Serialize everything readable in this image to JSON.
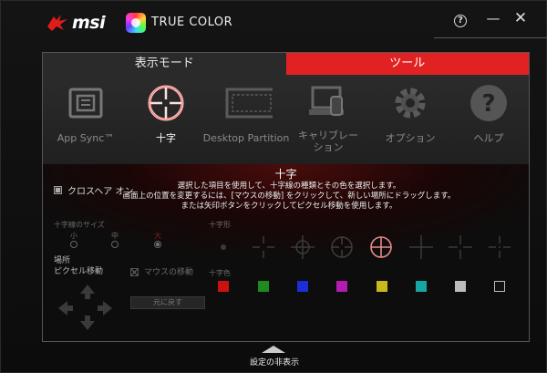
{
  "header": {
    "brand": "msi",
    "product": "TRUE COLOR",
    "help_symbol": "?",
    "minimize_symbol": "—",
    "close_symbol": "✕"
  },
  "tabs": [
    {
      "label": "表示モード",
      "active": false
    },
    {
      "label": "ツール",
      "active": true
    }
  ],
  "tools": [
    {
      "label": "App Sync™",
      "icon": "app-sync-icon"
    },
    {
      "label": "十字",
      "icon": "crosshair-icon",
      "active": true
    },
    {
      "label": "Desktop Partition",
      "icon": "desktop-partition-icon"
    },
    {
      "label": "キャリブレー\nション",
      "icon": "calibration-icon"
    },
    {
      "label": "オプション",
      "icon": "gear-icon"
    },
    {
      "label": "ヘルプ",
      "icon": "help-icon"
    }
  ],
  "crosshair": {
    "title": "十字",
    "description_1": "選択した項目を使用して、十字線の種類とその色を選択します。",
    "description_2": "画面上の位置を変更するには、[マウスの移動] をクリックして、新しい場所にドラッグします。",
    "description_3": "または矢印ボタンをクリックしてピクセル移動を使用します。",
    "toggle_label": "クロスヘア オン",
    "size_label": "十字線のサイズ",
    "size_small": "小",
    "size_medium": "中",
    "size_large": "大",
    "location_label": "場所",
    "pixel_move_label": "ピクセル移動",
    "mouse_move_label": "マウスの移動",
    "reset_label": "元に戻す",
    "shape_label": "十字形",
    "color_label": "十字色",
    "colors": [
      "#cc1111",
      "#1f8a1f",
      "#1c2ed8",
      "#b21cb2",
      "#c9b81c",
      "#16a6a6",
      "#bcbcbc",
      "#111111"
    ]
  },
  "footer": {
    "hide_settings_label": "設定の非表示"
  }
}
